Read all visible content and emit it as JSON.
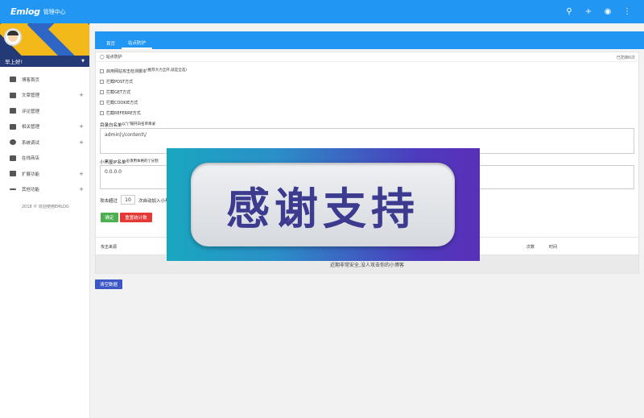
{
  "topbar": {
    "logo": "Emlog",
    "title": "管理中心",
    "icons": [
      "search-icon",
      "plus-icon",
      "palette-icon",
      "more-vert-icon"
    ]
  },
  "sidebar": {
    "greeting": "早上好!",
    "items": [
      {
        "label": "博客首页",
        "icon": "monitor-icon",
        "expandable": false
      },
      {
        "label": "文章管理",
        "icon": "document-icon",
        "expandable": true
      },
      {
        "label": "评论管理",
        "icon": "comment-icon",
        "expandable": false
      },
      {
        "label": "相关管理",
        "icon": "list-icon",
        "expandable": true
      },
      {
        "label": "系统调试",
        "icon": "gear-icon",
        "expandable": true
      },
      {
        "label": "在线商店",
        "icon": "store-icon",
        "expandable": false
      },
      {
        "label": "扩展功能",
        "icon": "extension-icon",
        "expandable": true
      },
      {
        "label": "其他功能",
        "icon": "more-icon",
        "expandable": true
      }
    ],
    "footer": "2018 © 欢迎使用EMLOG"
  },
  "main": {
    "tabs": [
      {
        "label": "首页",
        "active": false
      },
      {
        "label": "站点防护",
        "active": true
      }
    ],
    "panel": {
      "title": "站点防护",
      "right_text": "已防御0次",
      "options": [
        {
          "label": "启用网站攻击检测脚本",
          "note": "(推荐大力全开,就是全选)"
        },
        {
          "label": "拦截POST方式",
          "note": ""
        },
        {
          "label": "拦截GET方式",
          "note": ""
        },
        {
          "label": "拦截COOKIE方式",
          "note": ""
        },
        {
          "label": "拦截REFERRE方式",
          "note": ""
        }
      ],
      "whitelist_label": "目录白名单",
      "whitelist_note": "以\"|\"隔开白名单目录",
      "whitelist_value": "admin|\\/content\\/",
      "blacklist_label": "小黑屋IP名单",
      "blacklist_note": "必须用本格的'|'分割",
      "blacklist_value": "0.0.0.0",
      "attack_prefix": "攻击超过",
      "attack_count": "10",
      "attack_suffix": "次自动加入小黑",
      "confirm_button": "确定",
      "reset_button": "重置统计数"
    },
    "table": {
      "columns": [
        "攻击来源",
        "次数",
        "时间"
      ],
      "empty_text": "近期非常安全,没人攻击你的小博客"
    },
    "clear_button": "清空数据"
  },
  "overlay": {
    "text": "感谢支持"
  }
}
